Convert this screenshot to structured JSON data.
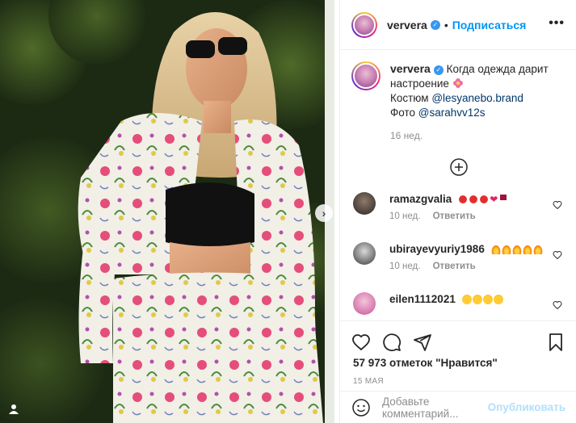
{
  "post": {
    "author": "ververa",
    "follow_label": "Подписаться",
    "separator": "•",
    "more_label": "•••"
  },
  "caption": {
    "author": "ververa",
    "text_1": "Когда одежда дарит настроение",
    "line_2_prefix": "Костюм",
    "mention_1": "@lesyanebo.brand",
    "line_3_prefix": "Фото",
    "mention_2": "@sarahvv12s",
    "time": "16 нед."
  },
  "comments": [
    {
      "user": "ramazgvalia",
      "time": "10 нед.",
      "reply": "Ответить",
      "emojis": [
        "rose",
        "rose",
        "rose",
        "heart",
        "wine"
      ]
    },
    {
      "user": "ubirayevyuriy1986",
      "time": "10 нед.",
      "reply": "Ответить",
      "emojis": [
        "fire",
        "fire",
        "fire",
        "fire",
        "fire"
      ]
    },
    {
      "user": "eilen1112021",
      "time": "",
      "reply": "",
      "emojis": [
        "heart-eyes",
        "heart-eyes",
        "heart-eyes",
        "heart-eyes"
      ]
    }
  ],
  "actions": {
    "likes": "57 973 отметок \"Нравится\"",
    "date": "15 МАЯ",
    "comment_placeholder": "Добавьте комментарий...",
    "publish_label": "Опубликовать"
  },
  "icons": {
    "like": "heart-icon",
    "comment": "comment-icon",
    "share": "share-icon",
    "save": "bookmark-icon",
    "emoji": "smile-icon",
    "more_comments": "plus-circle-icon",
    "next": "chevron-right-icon",
    "tag": "user-tag-icon"
  },
  "colors": {
    "accent": "#0095f6",
    "verified": "#3897f0",
    "muted": "#8e8e8e",
    "publish_disabled": "#b2dffc"
  }
}
